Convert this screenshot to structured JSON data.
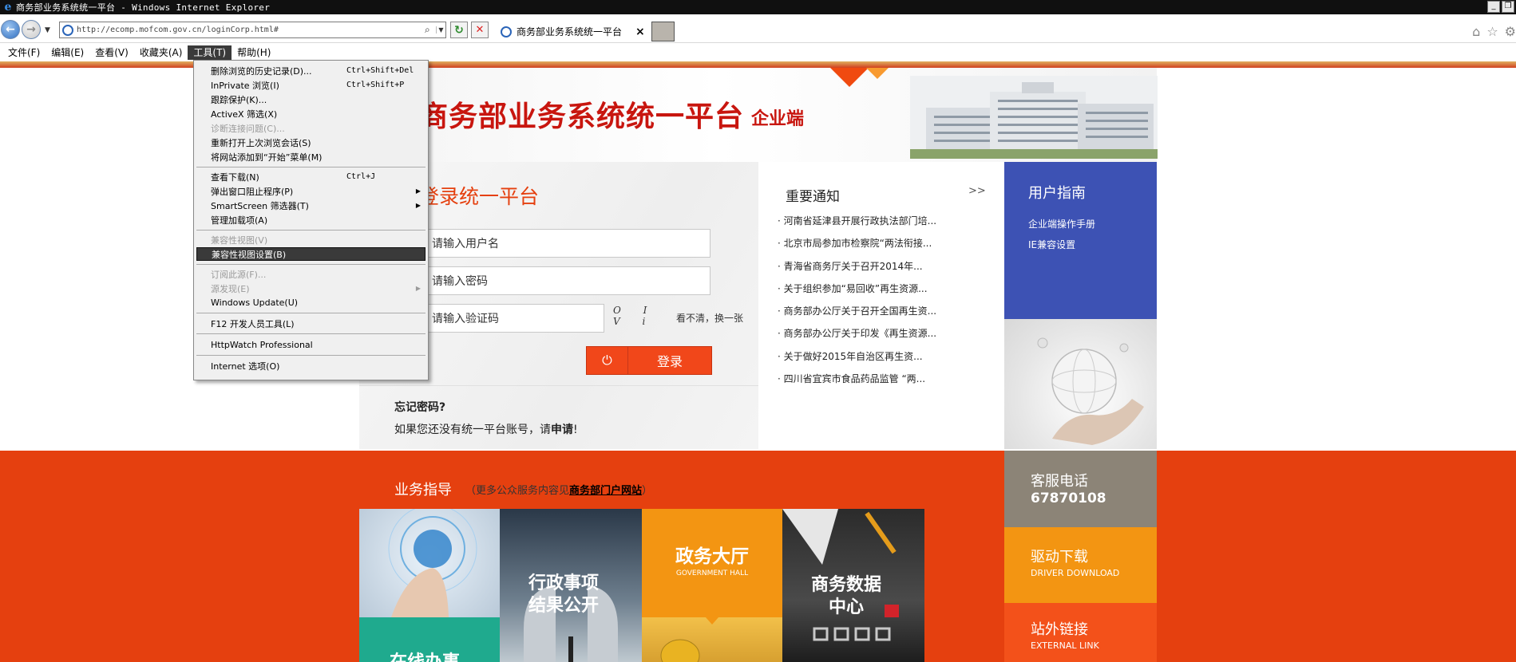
{
  "window": {
    "title": "商务部业务系统统一平台 - Windows Internet Explorer"
  },
  "browser": {
    "url": "http://ecomp.mofcom.gov.cn/loginCorp.html#",
    "tab_title": "商务部业务系统统一平台",
    "tab_close": "×"
  },
  "menubar": [
    "文件(F)",
    "编辑(E)",
    "查看(V)",
    "收藏夹(A)",
    "工具(T)",
    "帮助(H)"
  ],
  "tools_menu": {
    "items": [
      {
        "label": "删除浏览的历史记录(D)...",
        "shortcut": "Ctrl+Shift+Del"
      },
      {
        "label": "InPrivate 浏览(I)",
        "shortcut": "Ctrl+Shift+P"
      },
      {
        "label": "跟踪保护(K)..."
      },
      {
        "label": "ActiveX 筛选(X)"
      },
      {
        "label": "诊断连接问题(C)..."
      },
      {
        "label": "重新打开上次浏览会话(S)"
      },
      {
        "label": "将网站添加到“开始”菜单(M)"
      },
      {
        "label": "查看下载(N)",
        "shortcut": "Ctrl+J"
      },
      {
        "label": "弹出窗口阻止程序(P)"
      },
      {
        "label": "SmartScreen 筛选器(T)"
      },
      {
        "label": "管理加载项(A)"
      },
      {
        "label": "兼容性视图(V)"
      },
      {
        "label": "兼容性视图设置(B)"
      },
      {
        "label": "订阅此源(F)..."
      },
      {
        "label": "源发现(E)"
      },
      {
        "label": "Windows Update(U)"
      },
      {
        "label": "F12 开发人员工具(L)"
      },
      {
        "label": "HttpWatch Professional"
      },
      {
        "label": "Internet 选项(O)"
      }
    ]
  },
  "header": {
    "title": "商务部业务系统统一平台",
    "subtitle": "企业端"
  },
  "login": {
    "title": "登录统一平台",
    "username_placeholder": "请输入用户名",
    "password_placeholder": "请输入密码",
    "captcha_placeholder": "请输入验证码",
    "captcha_chars": "O I V i",
    "captcha_refresh": "看不清，换一张",
    "login_button": "登录",
    "forgot": "忘记密码?",
    "no_account_prefix": "如果您还没有统一平台账号，请",
    "no_account_link": "申请",
    "no_account_suffix": "!"
  },
  "notices": {
    "title": "重要通知",
    "more": ">>",
    "items": [
      "河南省延津县开展行政执法部门培...",
      "北京市局参加市检察院“两法衔接...",
      "青海省商务厅关于召开2014年...",
      "关于组织参加“易回收”再生资源...",
      "商务部办公厅关于召开全国再生资...",
      "商务部办公厅关于印发《再生资源...",
      "关于做好2015年自治区再生资...",
      "四川省宜宾市食品药品监管 “两..."
    ]
  },
  "guide": {
    "title": "用户指南",
    "links": [
      "企业端操作手册",
      "IE兼容设置"
    ]
  },
  "business": {
    "title": "业务指导",
    "sub_prefix": "（更多公众服务内容见",
    "sub_link": "商务部门户网站",
    "sub_suffix": "）",
    "tiles": {
      "admin": "行政事项\n结果公开",
      "hall": "政务大厅",
      "hall_en": "GOVERNMENT HALL",
      "data": "商务数据\n中心",
      "online": "在线办事"
    }
  },
  "side": {
    "phone_title": "客服电话",
    "phone_number": "67870108",
    "driver_title": "驱动下载",
    "driver_en": "DRIVER DOWNLOAD",
    "link_title": "站外链接",
    "link_en": "EXTERNAL LINK"
  },
  "colors": {
    "accent_red": "#e5400f",
    "title_red": "#c8160f",
    "guide_blue": "#3d52b4",
    "orange": "#f39512"
  },
  "icons": [
    "ie-logo-icon",
    "back-icon",
    "forward-icon",
    "refresh-icon",
    "stop-icon",
    "home-icon",
    "star-icon",
    "gear-icon",
    "power-icon"
  ]
}
